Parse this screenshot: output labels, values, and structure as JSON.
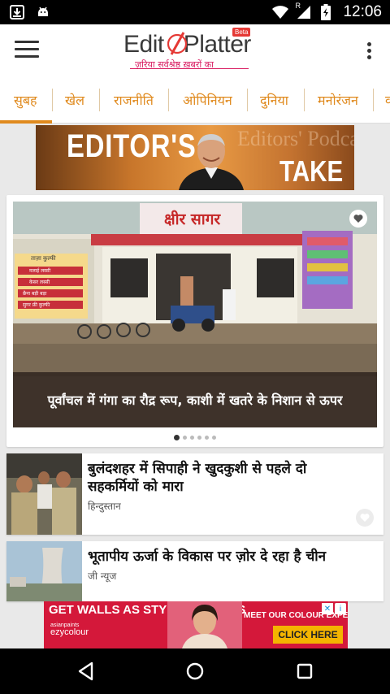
{
  "status_bar": {
    "time": "12:06",
    "icons": [
      "download-icon",
      "android-icon",
      "wifi-icon",
      "signal-icon",
      "battery-charging-icon"
    ],
    "signal_badge": "R"
  },
  "app_bar": {
    "logo_text_left": "Edit",
    "logo_text_right": "Platter",
    "logo_badge": "Beta",
    "logo_tagline": "ज़रिया सर्वश्रेष्ठ ख़बरों का"
  },
  "tabs": [
    {
      "label": "सुबह",
      "active": true
    },
    {
      "label": "खेल"
    },
    {
      "label": "राजनीति"
    },
    {
      "label": "ओपिनियन"
    },
    {
      "label": "दुनिया"
    },
    {
      "label": "मनोरंजन"
    },
    {
      "label": "व"
    }
  ],
  "banner": {
    "text_left": "EDITOR'S",
    "text_right": "TAKE",
    "faded_text": "Editors' Podcast"
  },
  "featured": {
    "image_sign": "क्षीर सागर",
    "side_sign": [
      "मलाई लस्सी",
      "केसर लस्सी",
      "छैना बड़ी बड़ा",
      "सुगर फ्री कुल्फी"
    ],
    "side_sign_header": "ताज़ा कुल्फी",
    "caption": "पूर्वांचल में गंगा का रौद्र रूप, काशी में खतरे के निशान से ऊपर",
    "carousel_total": 6,
    "carousel_active": 1
  },
  "news": [
    {
      "title": "बुलंदशहर में सिपाही ने खुदकुशी से पहले दो सहकर्मियों को मारा",
      "source": "हिन्दुस्तान"
    },
    {
      "title": "भूतापीय ऊर्जा के विकास पर ज़ोर दे रहा है चीन",
      "source": "जी न्यूज"
    }
  ],
  "ad": {
    "headline": "GET WALLS AS STYLISH AS THIS",
    "subline": "MEET OUR COLOUR EXPERT.",
    "brand": "ezycolour",
    "brand_prefix": "asianpaints",
    "cta": "CLICK HERE",
    "info_label": "i",
    "close_label": "✕"
  },
  "colors": {
    "accent": "#e08a1e",
    "ad_red": "#d4183a"
  }
}
